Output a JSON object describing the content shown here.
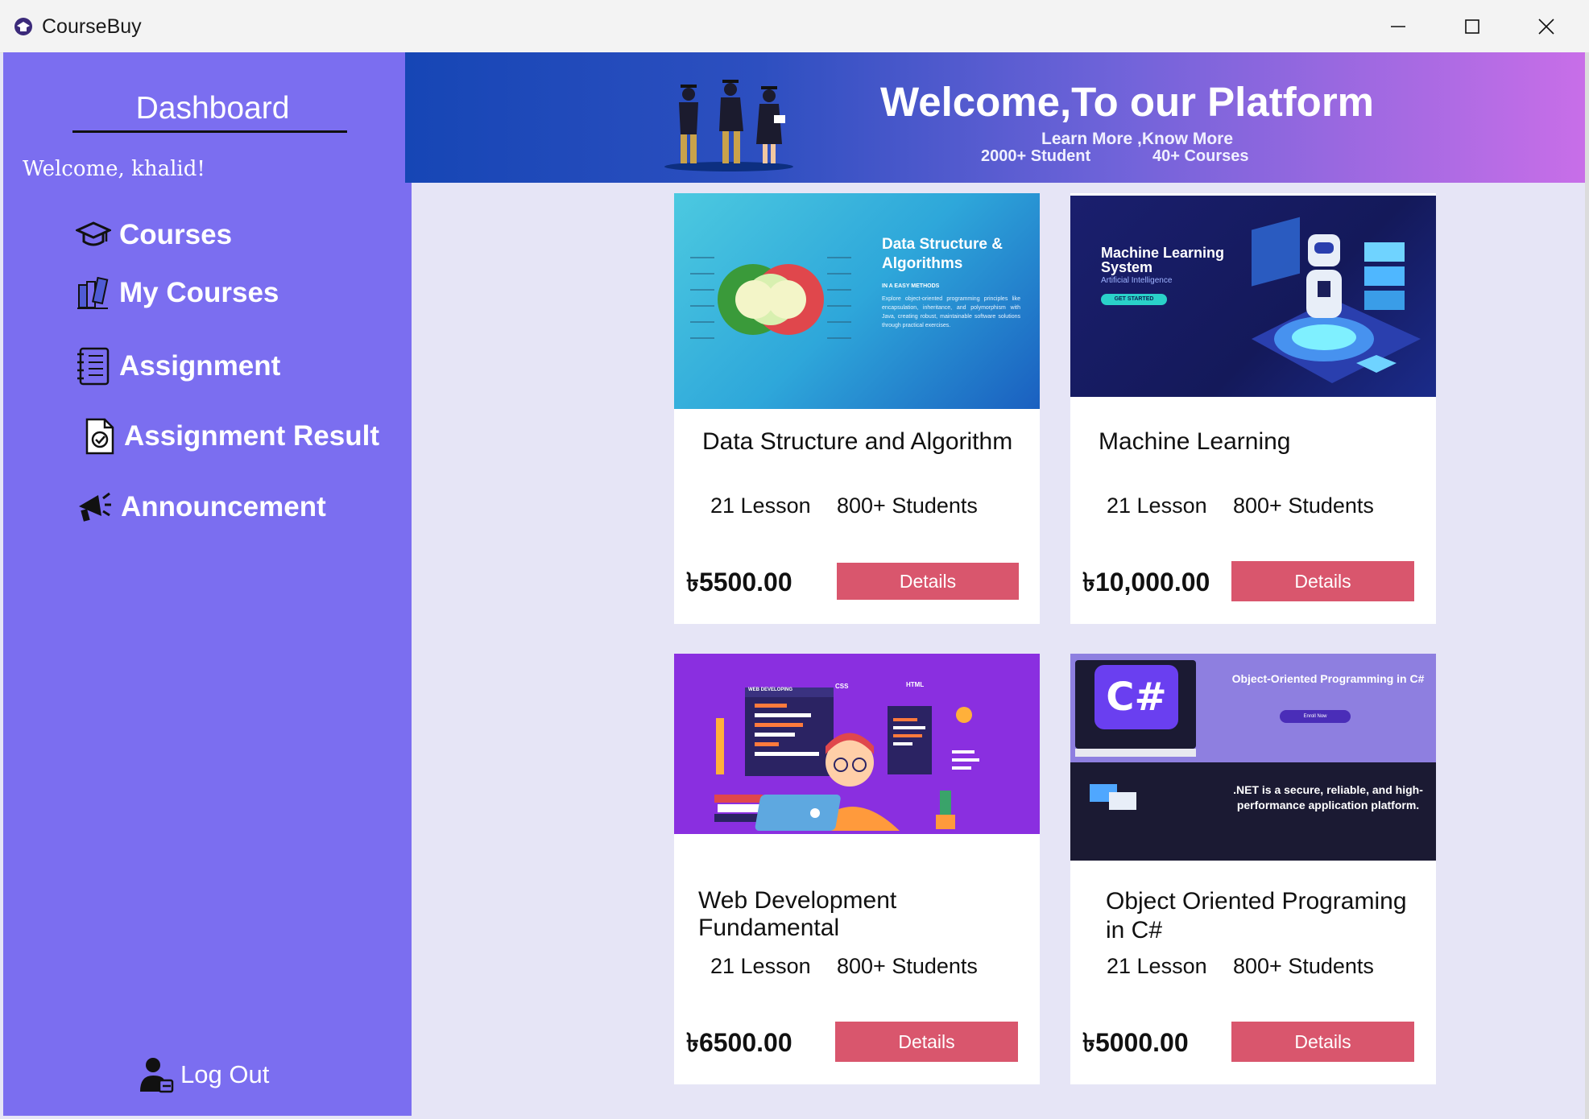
{
  "window": {
    "title": "CourseBuy"
  },
  "sidebar": {
    "title": "Dashboard",
    "welcome": "Welcome, khalid!",
    "items": [
      {
        "label": "Courses",
        "icon": "graduation-cap-icon"
      },
      {
        "label": "My Courses",
        "icon": "books-icon"
      },
      {
        "label": "Assignment",
        "icon": "notebook-icon"
      },
      {
        "label": "Assignment Result",
        "icon": "document-check-icon"
      },
      {
        "label": "Announcement",
        "icon": "megaphone-icon"
      }
    ],
    "logout": "Log Out"
  },
  "banner": {
    "title": "Welcome,To our Platform",
    "subtitle": "Learn More ,Know More",
    "stat_students": "2000+ Student",
    "stat_courses": "40+ Courses"
  },
  "courses": [
    {
      "title": "Data Structure and Algorithm",
      "lessons": "21 Lesson",
      "students": "800+ Students",
      "price": "৳5500.00",
      "button": "Details",
      "thumb_heading": "Data Structure & Algorithms",
      "thumb_tag": "IN A EASY METHODS",
      "thumb_desc": "Explore object-oriented programming principles like encapsulation, inheritance, and polymorphism with Java, creating robust, maintainable software solutions through practical exercises."
    },
    {
      "title": "Machine Learning",
      "lessons": "21 Lesson",
      "students": "800+ Students",
      "price": "৳10,000.00",
      "button": "Details",
      "thumb_heading": "Machine Learning System",
      "thumb_tag": "Artificial Intelligence",
      "thumb_cta": "GET STARTED"
    },
    {
      "title": "Web Development Fundamental",
      "lessons": "21 Lesson",
      "students": "800+ Students",
      "price": "৳6500.00",
      "button": "Details",
      "thumb_tag": "WEB DEVELOPING",
      "thumb_css": "CSS",
      "thumb_html": "HTML"
    },
    {
      "title": "Object Oriented Programing in C#",
      "lessons": "21 Lesson",
      "students": "800+ Students",
      "price": "৳5000.00",
      "button": "Details",
      "thumb_logo": "C#",
      "thumb_heading": "Object-Oriented Programming in C#",
      "thumb_cta": "Enroll Now",
      "thumb_desc": ".NET is a secure, reliable, and high-performance application platform."
    }
  ],
  "colors": {
    "sidebar": "#7b6ef0",
    "content_bg": "#e6e5f6",
    "button": "#d9566d"
  }
}
